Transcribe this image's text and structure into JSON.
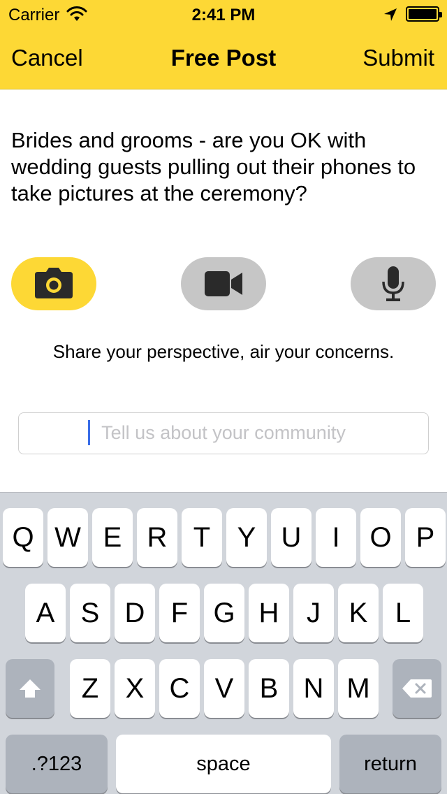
{
  "status_bar": {
    "carrier": "Carrier",
    "time": "2:41 PM"
  },
  "nav": {
    "cancel": "Cancel",
    "title": "Free Post",
    "submit": "Submit"
  },
  "question": "Brides and grooms - are you OK with wedding guests pulling out their phones to take pictures at the ceremony?",
  "media_buttons": [
    {
      "name": "photo",
      "icon": "camera-icon",
      "active": true
    },
    {
      "name": "video",
      "icon": "video-camera-icon",
      "active": false
    },
    {
      "name": "audio",
      "icon": "microphone-icon",
      "active": false
    }
  ],
  "tagline": "Share your perspective, air your concerns.",
  "input": {
    "placeholder": "Tell us about your community"
  },
  "keyboard": {
    "row1": [
      "Q",
      "W",
      "E",
      "R",
      "T",
      "Y",
      "U",
      "I",
      "O",
      "P"
    ],
    "row2": [
      "A",
      "S",
      "D",
      "F",
      "G",
      "H",
      "J",
      "K",
      "L"
    ],
    "row3": [
      "Z",
      "X",
      "C",
      "V",
      "B",
      "N",
      "M"
    ],
    "numbers": ".?123",
    "space": "space",
    "return": "return"
  },
  "colors": {
    "accent": "#fdd835",
    "inactive_button": "#c6c6c6",
    "keyboard_bg": "#d1d5db",
    "caret": "#3a6ee8"
  }
}
